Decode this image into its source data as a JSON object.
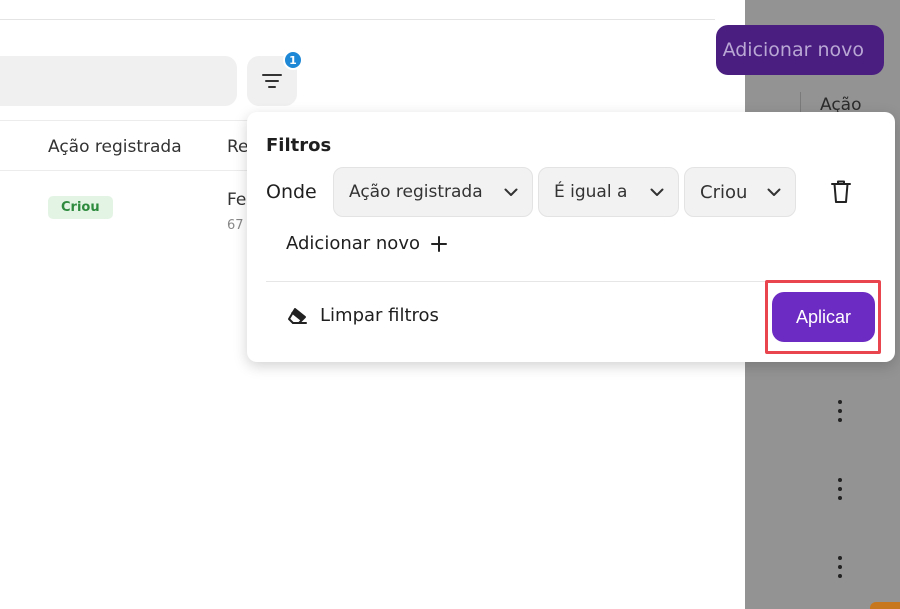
{
  "header": {
    "add_new_label": "Adicionar novo",
    "filter_badge_count": "1"
  },
  "table": {
    "columns": [
      "Ação registrada",
      "Re"
    ],
    "row": {
      "status": "Criou",
      "cell_text": "Fe",
      "cell_subtext": "67"
    },
    "actions_header": "Ação"
  },
  "filters": {
    "title": "Filtros",
    "where_label": "Onde",
    "field_value": "Ação registrada",
    "operator_value": "É igual a",
    "match_value": "Criou",
    "add_new_label": "Adicionar novo",
    "clear_label": "Limpar filtros",
    "apply_label": "Aplicar"
  },
  "colors": {
    "primary": "#6c2bc2",
    "badge": "#1e88d6",
    "status_bg": "#e3f4e5",
    "status_text": "#2e8b3e",
    "highlight": "#e8454f"
  },
  "icons": [
    "filter-icon",
    "chevron-down-icon",
    "trash-icon",
    "plus-icon",
    "eraser-icon",
    "kebab-menu-icon"
  ]
}
